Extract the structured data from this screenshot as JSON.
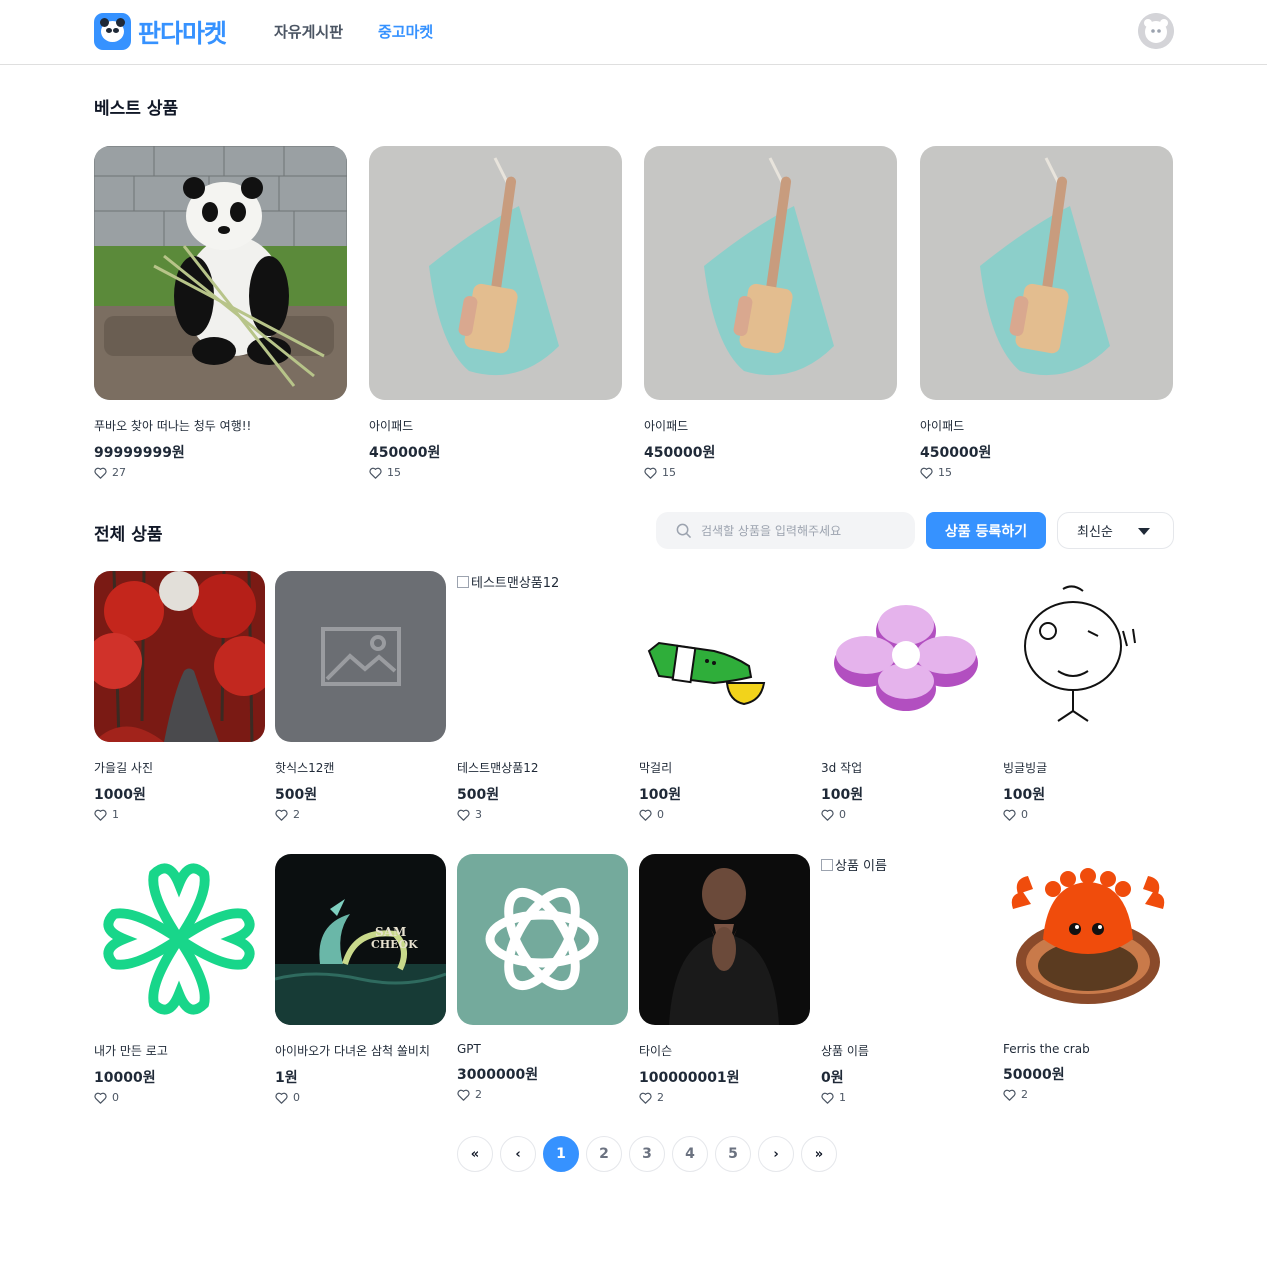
{
  "header": {
    "logo_text": "판다마켓",
    "nav": {
      "board": "자유게시판",
      "market": "중고마켓"
    }
  },
  "best": {
    "title": "베스트 상품",
    "items": [
      {
        "name": "푸바오 찾아 떠나는 청두 여행!!",
        "price": "99999999원",
        "likes": "27"
      },
      {
        "name": "아이패드",
        "price": "450000원",
        "likes": "15"
      },
      {
        "name": "아이패드",
        "price": "450000원",
        "likes": "15"
      },
      {
        "name": "아이패드",
        "price": "450000원",
        "likes": "15"
      }
    ]
  },
  "all": {
    "title": "전체 상품",
    "search_placeholder": "검색할 상품을 입력해주세요",
    "register_label": "상품 등록하기",
    "sort_label": "최신순",
    "items": [
      {
        "name": "가을길 사진",
        "price": "1000원",
        "likes": "1"
      },
      {
        "name": "핫식스12캔",
        "price": "500원",
        "likes": "2"
      },
      {
        "name": "테스트맨상품12",
        "price": "500원",
        "likes": "3",
        "alt": "테스트맨상품12"
      },
      {
        "name": "막걸리",
        "price": "100원",
        "likes": "0"
      },
      {
        "name": "3d 작업",
        "price": "100원",
        "likes": "0"
      },
      {
        "name": "빙글빙글",
        "price": "100원",
        "likes": "0"
      },
      {
        "name": "내가 만든 로고",
        "price": "10000원",
        "likes": "0"
      },
      {
        "name": "아이바오가 다녀온 삼척 쏠비치",
        "price": "1원",
        "likes": "0"
      },
      {
        "name": "GPT",
        "price": "3000000원",
        "likes": "2"
      },
      {
        "name": "타이슨",
        "price": "100000001원",
        "likes": "2"
      },
      {
        "name": "상품 이름",
        "price": "0원",
        "likes": "1",
        "alt": "상품 이름"
      },
      {
        "name": "Ferris the crab",
        "price": "50000원",
        "likes": "2"
      }
    ],
    "sam_text": [
      "SAM",
      "CHEOK"
    ]
  },
  "pagination": {
    "first": "«",
    "prev": "‹",
    "next": "›",
    "last": "»",
    "pages": [
      "1",
      "2",
      "3",
      "4",
      "5"
    ],
    "current": "1"
  },
  "colors": {
    "brand": "#3692ff",
    "text": "#1f2937",
    "muted": "#9ca3af"
  }
}
